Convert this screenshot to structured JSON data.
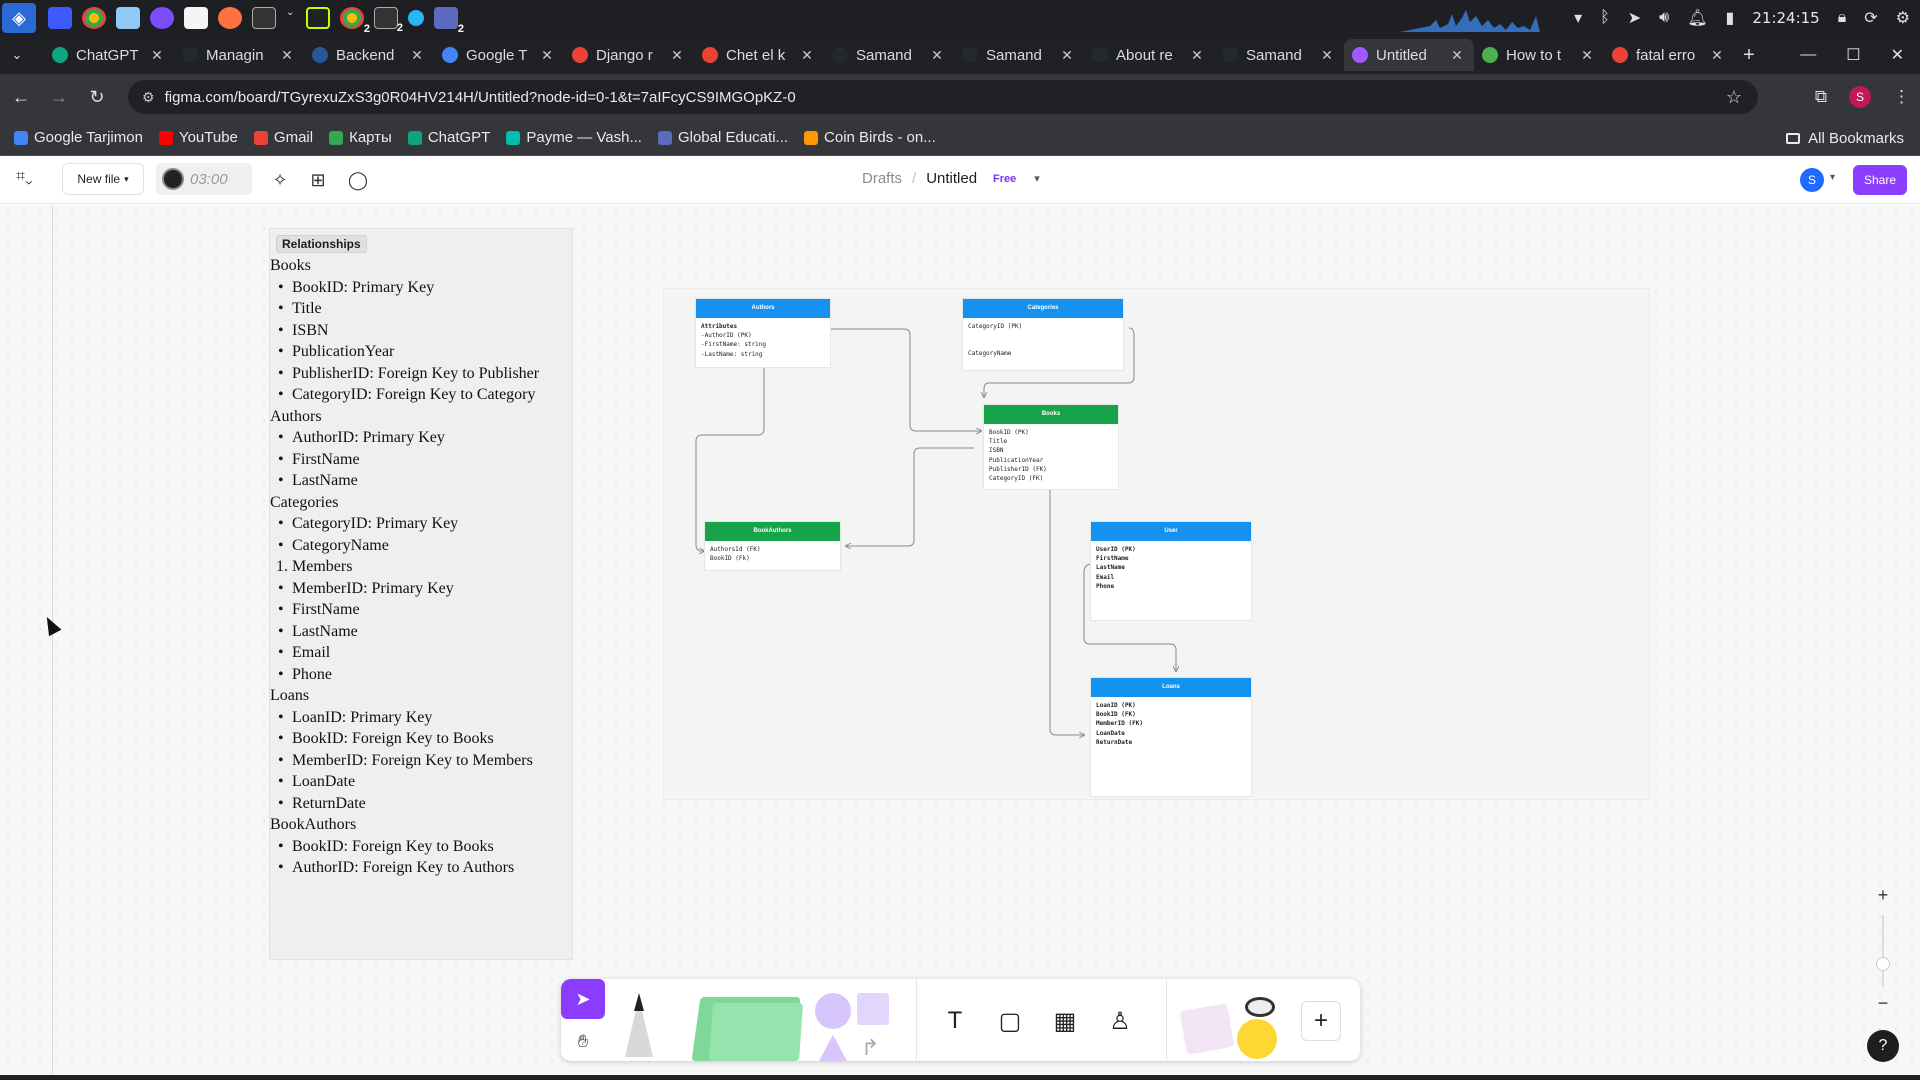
{
  "os": {
    "clock": "21:24:15",
    "app_counts": [
      "2",
      "2",
      "2"
    ]
  },
  "tabs": [
    {
      "title": "ChatGPT",
      "color": "#10a37f"
    },
    {
      "title": "Managin",
      "color": "#24292f"
    },
    {
      "title": "Backend",
      "color": "#2b579a"
    },
    {
      "title": "Google T",
      "color": "#4285f4"
    },
    {
      "title": "Django r",
      "color": "#ea4335"
    },
    {
      "title": "Chet el k",
      "color": "#ea4335"
    },
    {
      "title": "Samand",
      "color": "#24292f"
    },
    {
      "title": "Samand",
      "color": "#24292f"
    },
    {
      "title": "About re",
      "color": "#24292f"
    },
    {
      "title": "Samand",
      "color": "#24292f"
    },
    {
      "title": "Untitled",
      "color": "#a259ff",
      "active": true
    },
    {
      "title": "How to t",
      "color": "#4caf50"
    },
    {
      "title": "fatal erro",
      "color": "#ea4335"
    }
  ],
  "address": {
    "url": "figma.com/board/TGyrexuZxS3g0R04HV214H/Untitled?node-id=0-1&t=7aIFcyCS9IMGOpKZ-0",
    "profile_initial": "S"
  },
  "bookmarks": [
    {
      "label": "Google Tarjimon",
      "color": "#4285f4"
    },
    {
      "label": "YouTube",
      "color": "#ff0000"
    },
    {
      "label": "Gmail",
      "color": "#ea4335"
    },
    {
      "label": "Карты",
      "color": "#34a853"
    },
    {
      "label": "ChatGPT",
      "color": "#10a37f"
    },
    {
      "label": "Payme — Vash...",
      "color": "#00bfae"
    },
    {
      "label": "Global Educati...",
      "color": "#5c6bc0"
    },
    {
      "label": "Coin Birds - on...",
      "color": "#ff9800"
    }
  ],
  "bookmarks_all": "All Bookmarks",
  "figma": {
    "new_file": "New file",
    "timer": "03:00",
    "breadcrumb_drafts": "Drafts",
    "breadcrumb_sep": "/",
    "file_name": "Untitled",
    "plan_badge": "Free",
    "user_initial": "S",
    "share": "Share",
    "accent": "#8b3dff"
  },
  "relationships": {
    "tag": "Relationships",
    "groups": [
      {
        "heading": "Books",
        "items": [
          "BookID: Primary Key",
          "Title",
          "ISBN",
          "PublicationYear",
          "PublisherID: Foreign Key to Publisher",
          "CategoryID: Foreign Key to Category"
        ]
      },
      {
        "heading": "Authors",
        "items": [
          "AuthorID: Primary Key",
          "FirstName",
          "LastName"
        ]
      },
      {
        "heading": "Categories",
        "items": [
          "CategoryID: Primary Key",
          "CategoryName"
        ]
      },
      {
        "heading": "Members",
        "numbered": true,
        "items": [
          "MemberID: Primary Key",
          "FirstName",
          "LastName",
          "Email",
          "Phone"
        ]
      },
      {
        "heading": "Loans",
        "items": [
          "LoanID: Primary Key",
          "BookID: Foreign Key to Books",
          "MemberID: Foreign Key to Members",
          "LoanDate",
          "ReturnDate"
        ]
      },
      {
        "heading": "BookAuthors",
        "items": [
          "BookID: Foreign Key to Books",
          "AuthorID: Foreign Key to Authors"
        ]
      }
    ]
  },
  "diagram": {
    "authors": {
      "title": "Authors",
      "rows": [
        "Attributes",
        "-AuthorID (PK)",
        "-FirstName: string",
        "-LastName: string"
      ]
    },
    "categories": {
      "title": "Categories",
      "rows": [
        "CategoryID (PK)",
        "",
        "",
        "CategoryName"
      ]
    },
    "books": {
      "title": "Books",
      "rows": [
        "BookID (PK)",
        "Title",
        "ISBN",
        "PublicationYear",
        "PublisherID (FK)",
        "CategoryID (FK)"
      ]
    },
    "bookauthors": {
      "title": "BookAuthors",
      "rows": [
        "AuthorsId (FK)",
        "BookID (Fk)"
      ]
    },
    "user": {
      "title": "User",
      "rows": [
        "UserID (PK)",
        "FirstName",
        "LastName",
        "Email",
        "Phone"
      ]
    },
    "loans": {
      "title": "Loans",
      "rows": [
        "LoanID (PK)",
        "BookID (FK)",
        "MemberID (FK)",
        "LoanDate",
        "ReturnDate"
      ]
    }
  },
  "help": "?"
}
